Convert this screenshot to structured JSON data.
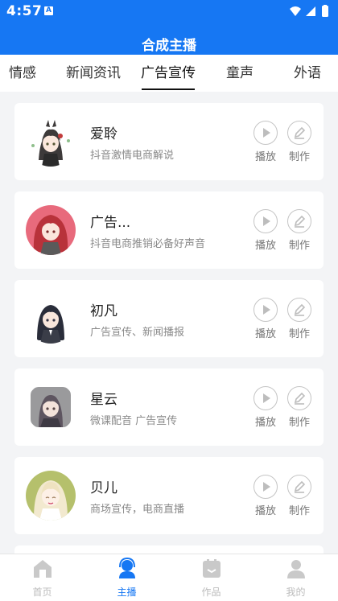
{
  "status_bar": {
    "time": "4:57",
    "badge": "A"
  },
  "header": {
    "title": "合成主播"
  },
  "tabs": [
    {
      "label": "情感",
      "active": false
    },
    {
      "label": "新闻资讯",
      "active": false
    },
    {
      "label": "广告宣传",
      "active": true
    },
    {
      "label": "童声",
      "active": false
    },
    {
      "label": "外语",
      "active": false
    }
  ],
  "anchors": [
    {
      "name": "爱聆",
      "desc": "抖音激情电商解说"
    },
    {
      "name": "广告...",
      "desc": "抖音电商推销必备好声音"
    },
    {
      "name": "初凡",
      "desc": "广告宣传、新闻播报"
    },
    {
      "name": "星云",
      "desc": "微课配音  广告宣传"
    },
    {
      "name": "贝儿",
      "desc": "商场宣传，电商直播"
    }
  ],
  "actions": {
    "play_label": "播放",
    "make_label": "制作"
  },
  "bottom_nav": [
    {
      "label": "首页",
      "active": false
    },
    {
      "label": "主播",
      "active": true
    },
    {
      "label": "作品",
      "active": false
    },
    {
      "label": "我的",
      "active": false
    }
  ],
  "colors": {
    "primary": "#1677f3",
    "inactive": "#bcbcbc",
    "background": "#f3f4f6"
  }
}
